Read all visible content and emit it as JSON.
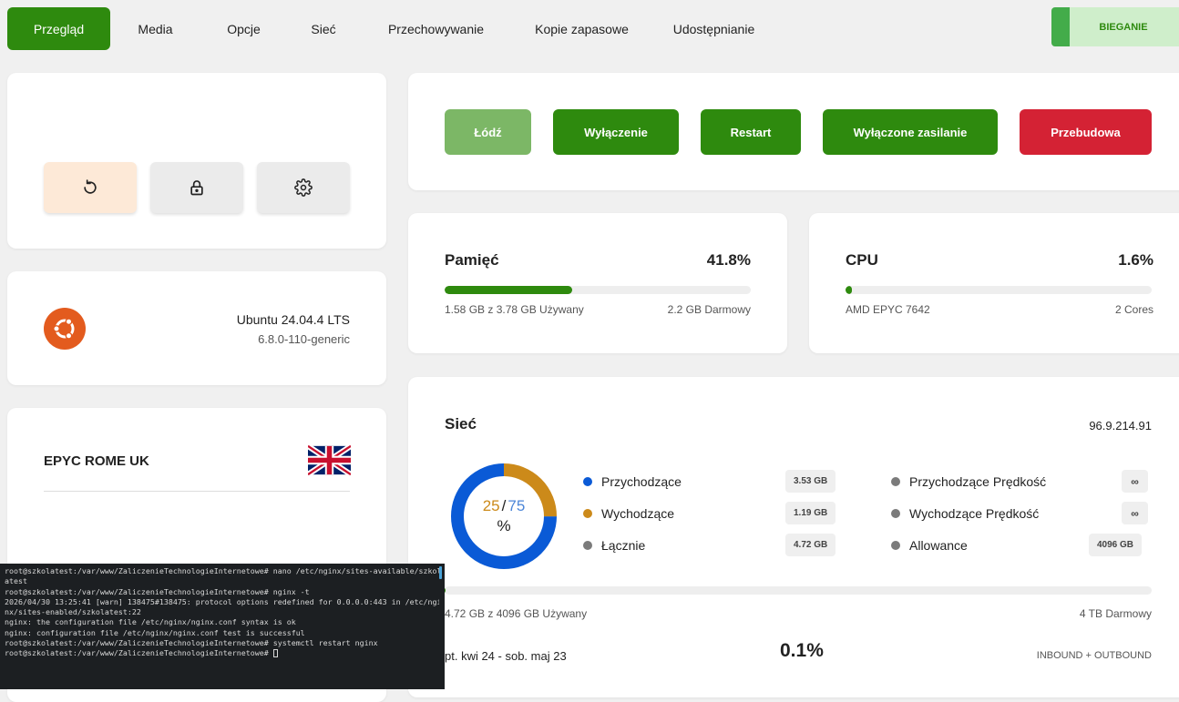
{
  "nav": {
    "tabs": [
      {
        "label": "Przegląd",
        "active": true
      },
      {
        "label": "Media"
      },
      {
        "label": "Opcje"
      },
      {
        "label": "Sieć"
      },
      {
        "label": "Przechowywanie"
      },
      {
        "label": "Kopie zapasowe"
      },
      {
        "label": "Udostępnianie"
      }
    ],
    "status": "BIEGANIE"
  },
  "quick_actions": [
    {
      "icon": "reinstall-icon"
    },
    {
      "icon": "lock-icon"
    },
    {
      "icon": "gear-icon"
    }
  ],
  "os": {
    "icon": "ubuntu-logo-icon",
    "name": "Ubuntu 24.04.4 LTS",
    "kernel": "6.8.0-110-generic"
  },
  "server": {
    "name": "EPYC ROME UK",
    "flag": "uk-flag-icon"
  },
  "actions": [
    {
      "label": "Łódź"
    },
    {
      "label": "Wyłączenie"
    },
    {
      "label": "Restart"
    },
    {
      "label": "Wyłączone zasilanie"
    },
    {
      "label": "Przebudowa"
    }
  ],
  "memory": {
    "title": "Pamięć",
    "percent_label": "41.8%",
    "percent": 41.8,
    "used": "1.58 GB z 3.78 GB Używany",
    "free": "2.2 GB Darmowy"
  },
  "cpu": {
    "title": "CPU",
    "percent_label": "1.6%",
    "percent": 1.6,
    "model": "AMD EPYC 7642",
    "cores": "2 Cores"
  },
  "network": {
    "title": "Sieć",
    "ip": "96.9.214.91",
    "donut": {
      "incoming": 75,
      "outgoing": 25,
      "out_label": "25",
      "in_label": "75",
      "sep": "/",
      "unit": "%"
    },
    "legend": [
      {
        "label": "Przychodzące",
        "value": "3.53 GB",
        "color": "#0a5ad6"
      },
      {
        "label": "Wychodzące",
        "value": "1.19 GB",
        "color": "#cc8a1a"
      },
      {
        "label": "Łącznie",
        "value": "4.72 GB",
        "color": "#7b7b7b"
      },
      {
        "label": "Przychodzące Prędkość",
        "value": "∞",
        "color": "#7b7b7b"
      },
      {
        "label": "Wychodzące Prędkość",
        "value": "∞",
        "color": "#7b7b7b"
      },
      {
        "label": "Allowance",
        "value": "4096 GB",
        "color": "#7b7b7b"
      }
    ],
    "usage_percent": 0.1,
    "used": "4.72 GB z 4096 GB Używany",
    "free": "4 TB Darmowy",
    "period": "pt. kwi 24 - sob. maj 23",
    "percent_label": "0.1%",
    "direction": "INBOUND + OUTBOUND"
  },
  "terminal": {
    "lines": [
      "root@szkolatest:/var/www/ZaliczenieTechnologieInternetowe# nano /etc/nginx/sites-available/szkol",
      "atest",
      "root@szkolatest:/var/www/ZaliczenieTechnologieInternetowe# nginx -t",
      "2026/04/30 13:25:41 [warn] 138475#138475: protocol options redefined for 0.0.0.0:443 in /etc/ngi",
      "nx/sites-enabled/szkolatest:22",
      "nginx: the configuration file /etc/nginx/nginx.conf syntax is ok",
      "nginx: configuration file /etc/nginx/nginx.conf test is successful",
      "root@szkolatest:/var/www/ZaliczenieTechnologieInternetowe# systemctl restart nginx",
      "root@szkolatest:/var/www/ZaliczenieTechnologieInternetowe# "
    ]
  }
}
